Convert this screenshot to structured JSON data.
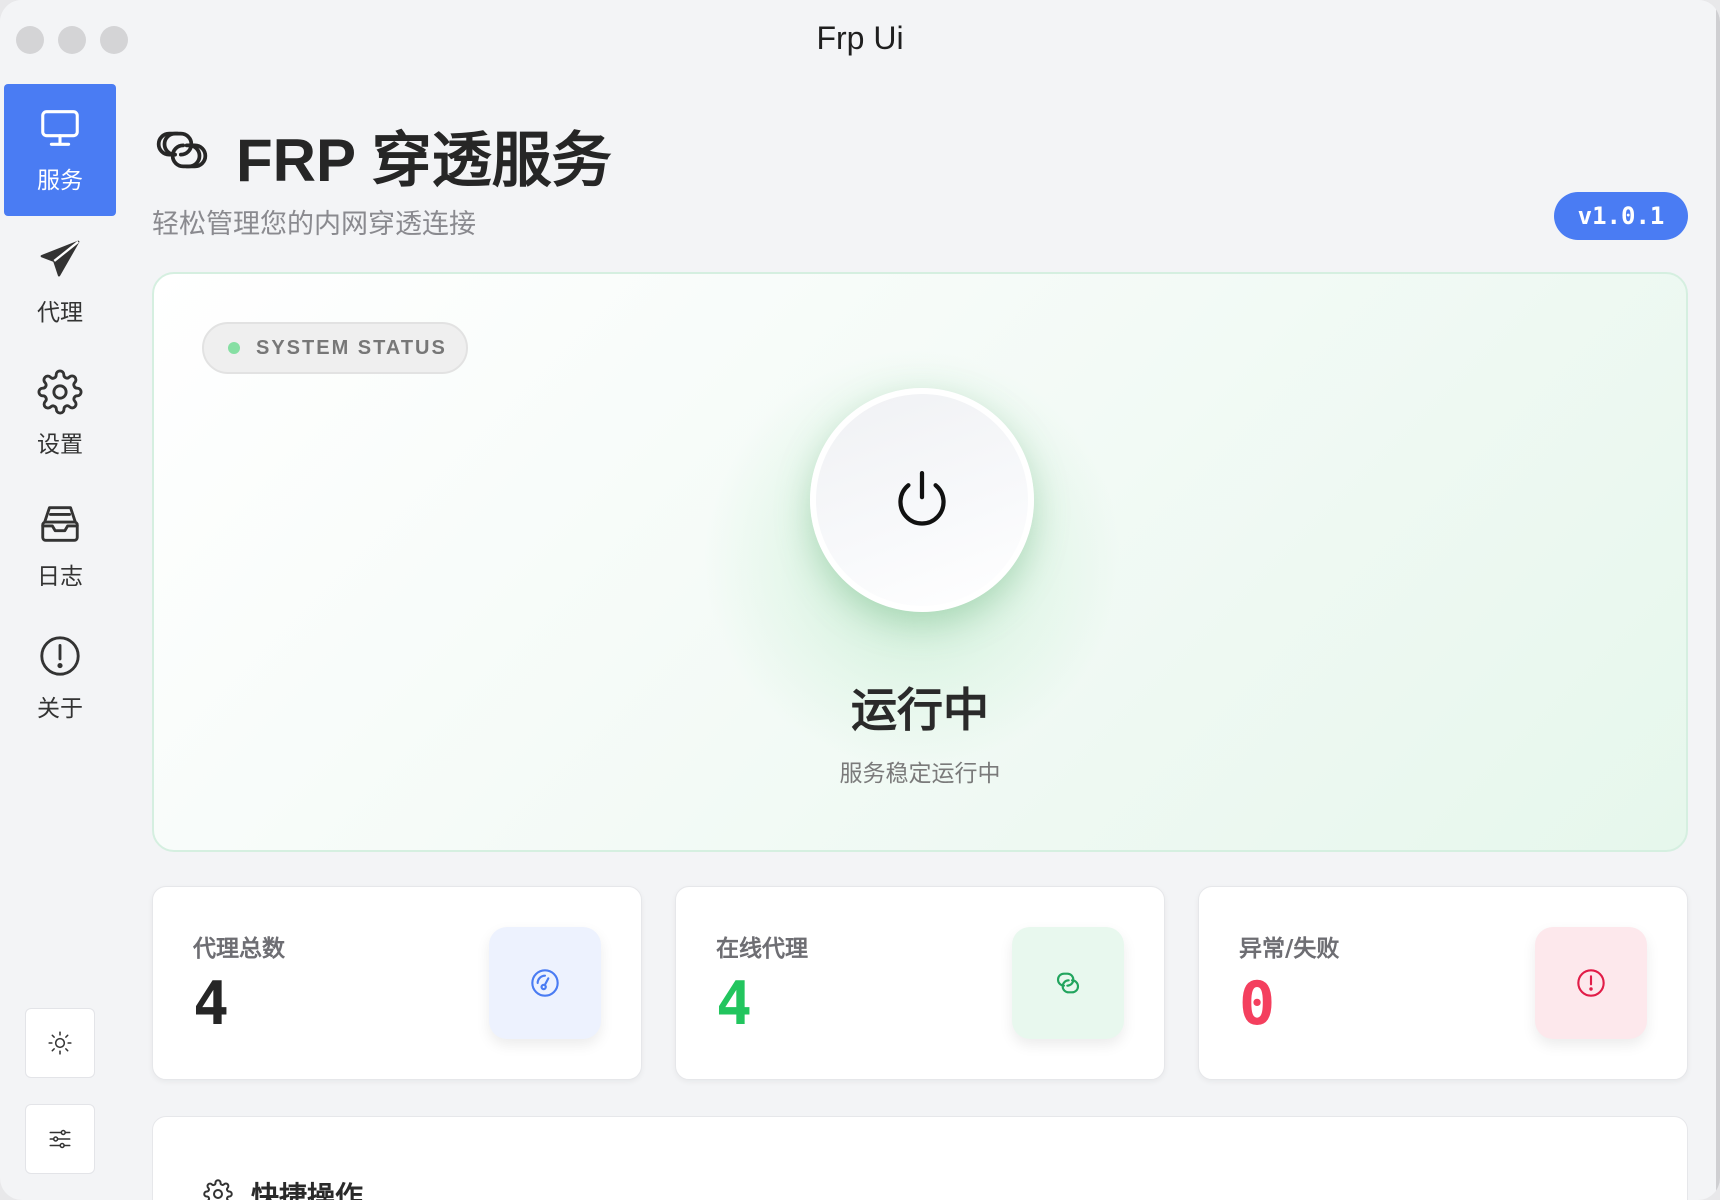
{
  "window": {
    "title": "Frp Ui"
  },
  "sidebar": {
    "items": [
      {
        "label": "服务",
        "icon": "monitor-icon",
        "active": true
      },
      {
        "label": "代理",
        "icon": "paper-plane-icon",
        "active": false
      },
      {
        "label": "设置",
        "icon": "gear-icon",
        "active": false
      },
      {
        "label": "日志",
        "icon": "inbox-icon",
        "active": false
      },
      {
        "label": "关于",
        "icon": "info-circle-icon",
        "active": false
      }
    ],
    "bottom_buttons": [
      {
        "icon": "sun-icon"
      },
      {
        "icon": "sliders-icon"
      }
    ]
  },
  "header": {
    "title": "FRP 穿透服务",
    "subtitle": "轻松管理您的内网穿透连接",
    "version": "v1.0.1"
  },
  "status": {
    "pill_text": "SYSTEM STATUS",
    "title": "运行中",
    "subtitle": "服务稳定运行中",
    "accent_color": "#86dfa3"
  },
  "stats": [
    {
      "label": "代理总数",
      "value": "4",
      "color": "#262626",
      "icon": "gauge-icon",
      "icon_color": "#4a7cf3",
      "icon_bg": "#edf2fe"
    },
    {
      "label": "在线代理",
      "value": "4",
      "color": "#22c55e",
      "icon": "link-icon",
      "icon_color": "#22a55e",
      "icon_bg": "#e8f8ee"
    },
    {
      "label": "异常/失败",
      "value": "0",
      "color": "#f43f5e",
      "icon": "alert-circle-icon",
      "icon_color": "#e11d48",
      "icon_bg": "#fde8ec"
    }
  ],
  "quick_actions": {
    "title": "快捷操作"
  },
  "colors": {
    "accent": "#4a7cf3"
  }
}
